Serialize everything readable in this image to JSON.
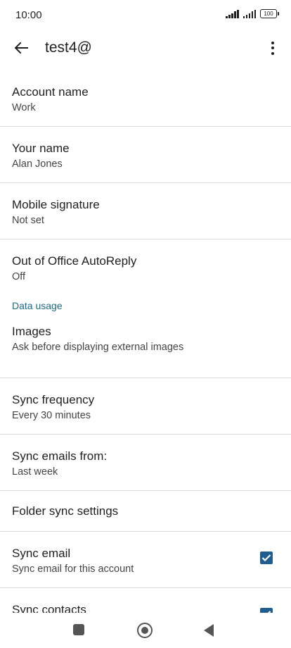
{
  "status_bar": {
    "time": "10:00",
    "battery": "100"
  },
  "app_bar": {
    "title": "test4@"
  },
  "settings": {
    "account_name": {
      "title": "Account name",
      "value": "Work"
    },
    "your_name": {
      "title": "Your name",
      "value": "Alan Jones"
    },
    "mobile_signature": {
      "title": "Mobile signature",
      "value": "Not set"
    },
    "out_of_office": {
      "title": "Out of Office AutoReply",
      "value": "Off"
    },
    "section_data_usage": "Data usage",
    "images": {
      "title": "Images",
      "value": "Ask before displaying external images"
    },
    "sync_frequency": {
      "title": "Sync frequency",
      "value": "Every 30 minutes"
    },
    "sync_emails_from": {
      "title": "Sync emails from:",
      "value": "Last week"
    },
    "folder_sync": {
      "title": "Folder sync settings"
    },
    "sync_email": {
      "title": "Sync email",
      "value": "Sync email for this account",
      "checked": true
    },
    "sync_contacts": {
      "title": "Sync contacts",
      "checked": true
    }
  },
  "colors": {
    "accent": "#1f5e8e",
    "section_header": "#1f6a83"
  }
}
